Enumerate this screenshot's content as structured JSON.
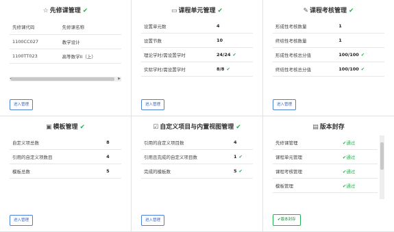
{
  "cards": {
    "prereq": {
      "title": "先修课管理",
      "columns": [
        "先修课代码",
        "先修课名称"
      ],
      "rows": [
        [
          "1100CC027",
          "教学设计"
        ],
        [
          "1100TT023",
          "高等数学II（上）"
        ]
      ],
      "enter": "进入管理"
    },
    "units": {
      "title": "课程单元管理",
      "rows": [
        [
          "设置单元数",
          "4"
        ],
        [
          "设置节数",
          "10"
        ],
        [
          "理论学时/需设置学时",
          "24/24"
        ],
        [
          "实际学时/需设置学时",
          "8/8"
        ]
      ],
      "enter": "进入管理"
    },
    "assessment": {
      "title": "课程考核管理",
      "rows": [
        [
          "形成性考核数量",
          "1"
        ],
        [
          "终结性考核数量",
          "1"
        ],
        [
          "形成性考核总分值",
          "100/100"
        ],
        [
          "终结性考核总分值",
          "100/100"
        ]
      ],
      "enter": "进入管理"
    },
    "template": {
      "title": "模板管理",
      "rows": [
        [
          "自定义项总数",
          "8"
        ],
        [
          "引用的自定义项数目",
          "4"
        ],
        [
          "模板总数",
          "5"
        ]
      ],
      "enter": "进入管理"
    },
    "custom": {
      "title": "自定义项目与内置视图管理",
      "rows": [
        [
          "引用的自定义项目数",
          "4"
        ],
        [
          "引用且完成的自定义项目数",
          "1"
        ],
        [
          "完成的模板数",
          "5"
        ]
      ],
      "enter": "进入管理"
    },
    "archive": {
      "title": "版本封存",
      "rows": [
        [
          "先修课管理",
          "通过"
        ],
        [
          "课程单元管理",
          "通过"
        ],
        [
          "课程考核管理",
          "通过"
        ],
        [
          "模板管理",
          "通过"
        ]
      ],
      "button": "版本封存"
    }
  },
  "colors": {
    "accent": "#2f63c4",
    "ok": "#22b14c"
  }
}
